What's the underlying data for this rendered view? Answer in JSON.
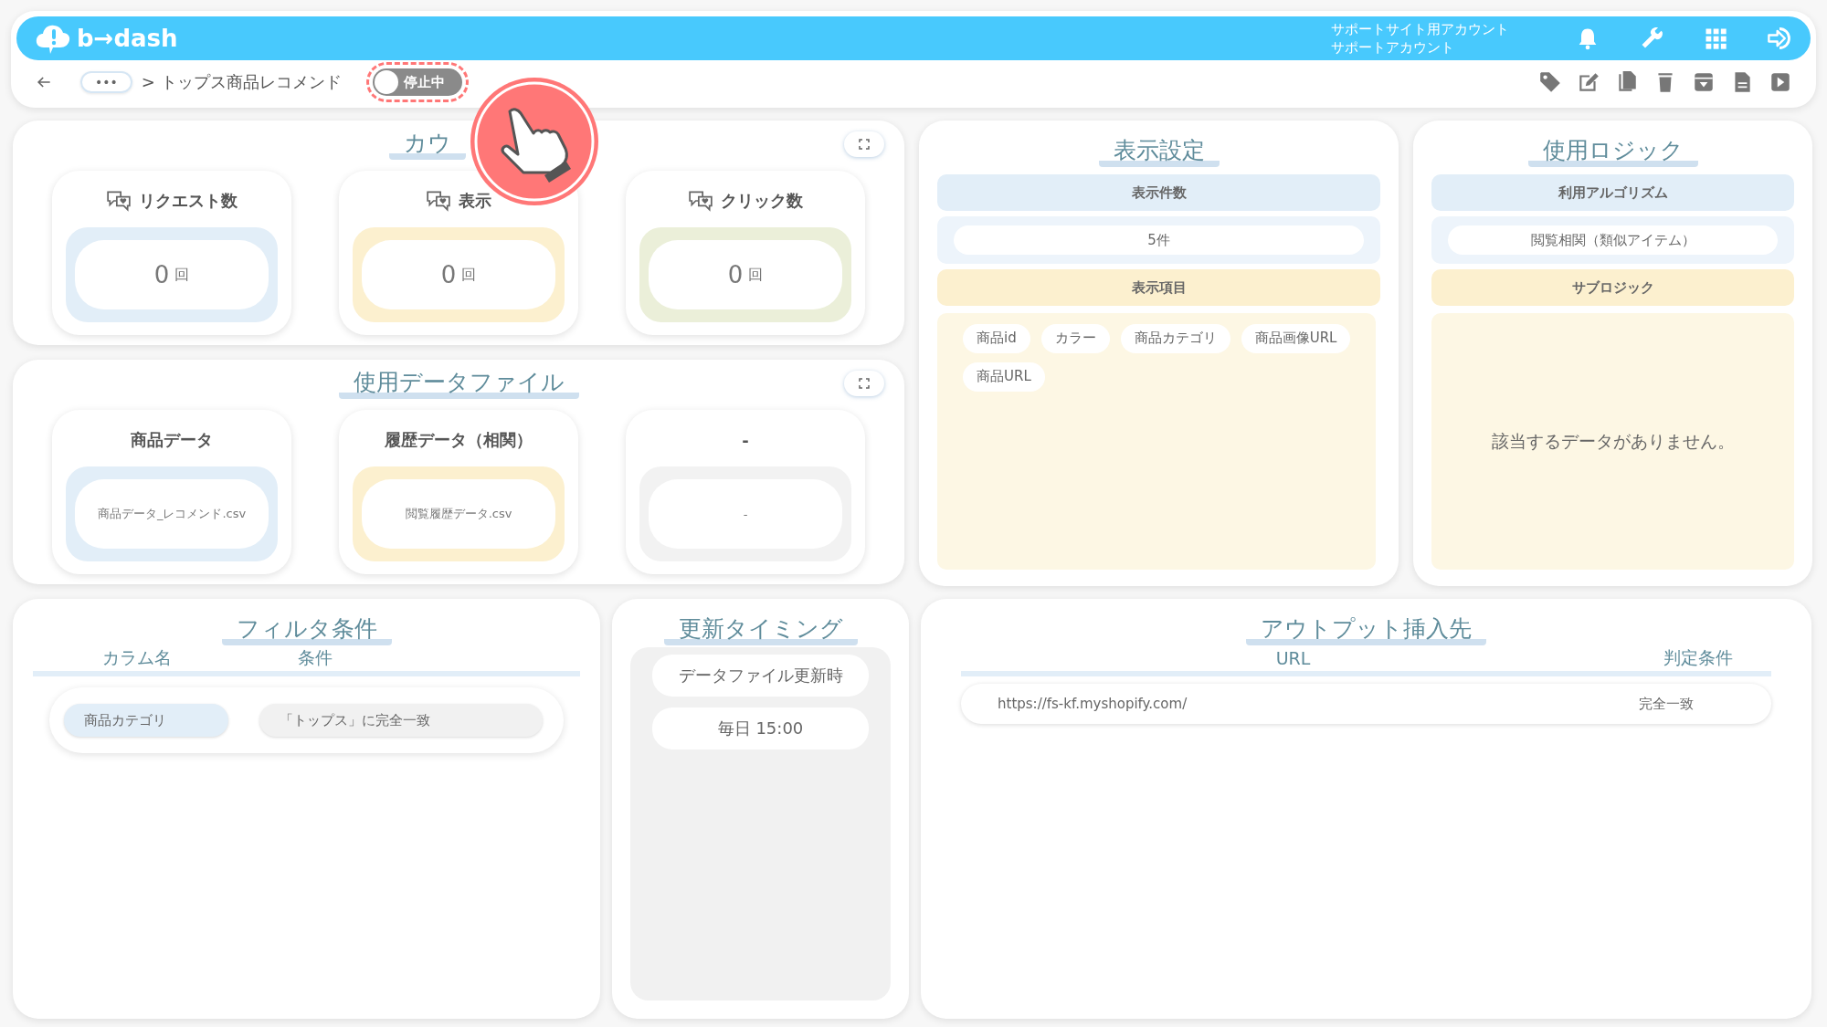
{
  "header": {
    "logo": "b→dash",
    "account_lines": [
      "サポートサイト用アカウント",
      "サポートアカウント"
    ]
  },
  "toolbar": {
    "breadcrumb_more": "•••",
    "breadcrumb": "> トップス商品レコメンド",
    "status_toggle": {
      "label": "停止中",
      "on": false
    }
  },
  "count_panel": {
    "title": "カウ",
    "kind": "counts",
    "cards": [
      {
        "title": "リクエスト数",
        "value": "0",
        "unit": "回",
        "color": "#e2eef8"
      },
      {
        "title": "表示",
        "value": "0",
        "unit": "回",
        "color": "#fcf0cf"
      },
      {
        "title": "クリック数",
        "value": "0",
        "unit": "回",
        "color": "#ebefd9"
      }
    ]
  },
  "file_panel": {
    "title": "使用データファイル",
    "kind": "files",
    "cards": [
      {
        "title": "商品データ",
        "value": "商品データ_レコメンド.csv",
        "color": "#e2eef8"
      },
      {
        "title": "履歴データ（相関）",
        "value": "閲覧履歴データ.csv",
        "color": "#fcf0cf"
      },
      {
        "title": "-",
        "value": "-",
        "color": "#f2f2f2"
      }
    ]
  },
  "display_settings": {
    "title": "表示設定",
    "count_label": "表示件数",
    "count_value": "5件",
    "items_label": "表示項目",
    "items": [
      "商品id",
      "カラー",
      "商品カテゴリ",
      "商品画像URL",
      "商品URL"
    ]
  },
  "logic": {
    "title": "使用ロジック",
    "algorithm_label": "利用アルゴリズム",
    "algorithm_value": "閲覧相関（類似アイテム）",
    "sub_label": "サブロジック",
    "empty_message": "該当するデータがありません。"
  },
  "filter": {
    "title": "フィルタ条件",
    "columns": [
      "カラム名",
      "条件"
    ],
    "rows": [
      {
        "column": "商品カテゴリ",
        "condition": "「トップス」に完全一致"
      }
    ]
  },
  "timing": {
    "title": "更新タイミング",
    "items": [
      "データファイル更新時",
      "毎日 15:00"
    ]
  },
  "output": {
    "title": "アウトプット挿入先",
    "columns": [
      "URL",
      "判定条件"
    ],
    "rows": [
      {
        "url": "https://fs-kf.myshopify.com/",
        "match": "完全一致"
      }
    ]
  }
}
